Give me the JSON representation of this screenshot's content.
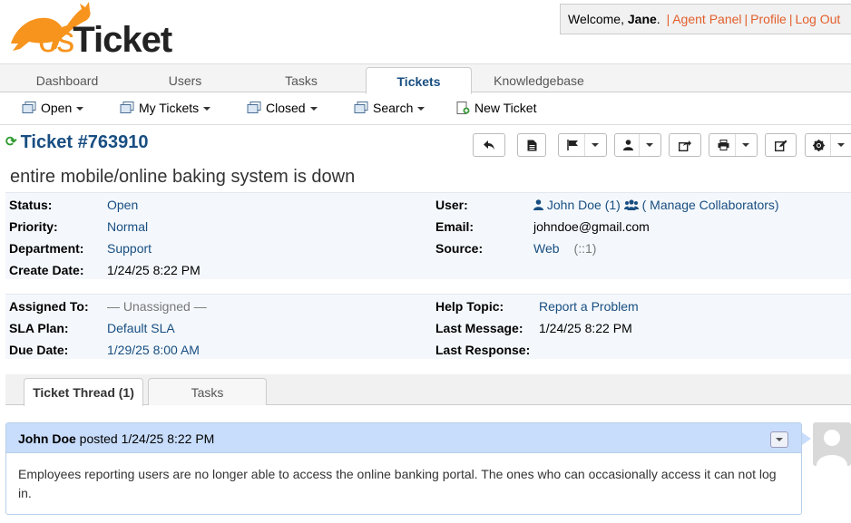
{
  "brand": {
    "logo_text_os": "os",
    "logo_text_ticket": "Ticket"
  },
  "userinfo": {
    "welcome": "Welcome, ",
    "name": "Jane",
    "after_name": ". ",
    "agent_panel": "Agent Panel",
    "profile": "Profile",
    "logout": "Log Out",
    "separator": "|"
  },
  "nav": {
    "tabs": [
      {
        "label": "Dashboard"
      },
      {
        "label": "Users"
      },
      {
        "label": "Tasks"
      },
      {
        "label": "Tickets"
      },
      {
        "label": "Knowledgebase"
      }
    ],
    "active": "Tickets"
  },
  "subnav": {
    "items": [
      {
        "label": "Open"
      },
      {
        "label": "My Tickets"
      },
      {
        "label": "Closed"
      },
      {
        "label": "Search"
      },
      {
        "label": "New Ticket"
      }
    ]
  },
  "ticket": {
    "title": "Ticket #763910",
    "subject": "entire mobile/online baking system is down",
    "status_label": "Status:",
    "status": "Open",
    "priority_label": "Priority:",
    "priority": "Normal",
    "department_label": "Department:",
    "department": "Support",
    "create_date_label": "Create Date:",
    "create_date": "1/24/25 8:22 PM",
    "user_label": "User:",
    "user_name": "John Doe",
    "user_count": "(1)",
    "manage_collab": "( Manage Collaborators)",
    "email_label": "Email:",
    "email": "johndoe@gmail.com",
    "source_label": "Source:",
    "source": "Web",
    "source_ip": "(::1)",
    "assigned_label": "Assigned To:",
    "assigned": "— Unassigned —",
    "sla_label": "SLA Plan:",
    "sla": "Default SLA",
    "due_label": "Due Date:",
    "due": "1/29/25 8:00 AM",
    "help_topic_label": "Help Topic:",
    "help_topic": "Report a Problem",
    "last_message_label": "Last Message:",
    "last_message": "1/24/25 8:22 PM",
    "last_response_label": "Last Response:",
    "last_response": ""
  },
  "thread_tabs": [
    {
      "label": "Ticket Thread (1)"
    },
    {
      "label": "Tasks"
    }
  ],
  "entry": {
    "author": "John Doe",
    "posted": " posted 1/24/25 8:22 PM",
    "body": "Employees reporting users are no longer able to access the online banking portal. The ones who can occasionally access it can not log in."
  },
  "colors": {
    "accent": "#184e81",
    "link_orange": "#e25f2b",
    "thread_header": "#c8ddfc"
  }
}
